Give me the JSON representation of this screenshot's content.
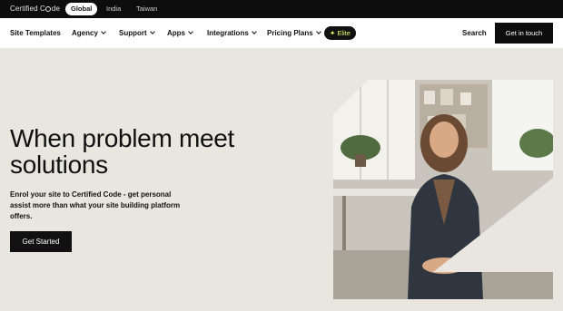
{
  "topbar": {
    "logo_prefix": "Certified C",
    "logo_suffix": "de",
    "regions": [
      "Global",
      "India",
      "Taiwan"
    ]
  },
  "nav": {
    "items": [
      "Site Templates",
      "Agency",
      "Support",
      "Apps",
      "Integrations",
      "Pricing Plans"
    ],
    "elite_label": "Elite",
    "search_label": "Search",
    "cta_label": "Get in touch"
  },
  "hero": {
    "headline": "When problem meet solutions",
    "subtext": "Enrol your site to Certified Code - get personal assist more than what your site building platform offers.",
    "button_label": "Get Started"
  },
  "colors": {
    "background": "#e9e6e0",
    "dark": "#0d0d0d",
    "elite_accent": "#e5ff6e"
  }
}
